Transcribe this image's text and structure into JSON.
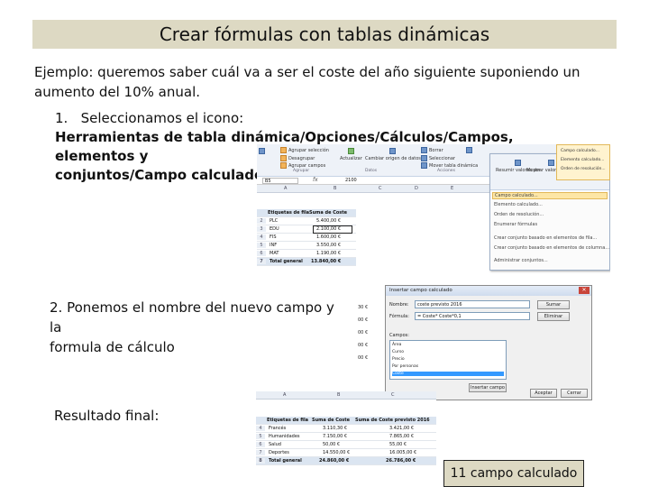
{
  "title": "Crear fórmulas con tablas dinámicas",
  "intro": "Ejemplo: queremos saber cuál va a ser el coste del año siguiente suponiendo un aumento del 10% anual.",
  "step1": {
    "number": "1.",
    "text": "Seleccionamos el icono:",
    "path_line1": "Herramientas de tabla dinámica/Opciones/Cálculos/Campos, elementos y",
    "path_line2": "conjuntos/Campo calculado"
  },
  "step2": {
    "line1": "2. Ponemos el nombre del nuevo campo y la",
    "line2": "formula de cálculo"
  },
  "step3": "Resultado final:",
  "caption": "11 campo calculado",
  "screenshot1": {
    "cell_ref": "B5",
    "fx": "fx",
    "formula_value": "2100",
    "columns": [
      "A",
      "B",
      "C",
      "D",
      "E"
    ],
    "ribbon_buttons": [
      "Agrupar selección",
      "Desagrupar",
      "Agrupar campos",
      "Actualizar",
      "Cambiar origen de datos",
      "Borrar",
      "Seleccionar",
      "Mover tabla dinámica",
      "Resumir valores por",
      "Mostrar valores como",
      "Campos, elementos y conjuntos",
      "Gráfico dinámico",
      "Herramientas OLAP"
    ],
    "ribbon_groups": [
      "Agrupar",
      "Datos",
      "Acciones",
      "Cálculos"
    ],
    "table_header": [
      "Etiquetas de fila",
      "Suma de Coste"
    ],
    "rows": [
      {
        "n": "2",
        "label": "PLC",
        "value": "5.400,00 €"
      },
      {
        "n": "3",
        "label": "EDU",
        "value": "2.100,00 €"
      },
      {
        "n": "4",
        "label": "FIS",
        "value": "1.600,00 €"
      },
      {
        "n": "5",
        "label": "INF",
        "value": "3.550,00 €"
      },
      {
        "n": "6",
        "label": "MAT",
        "value": "1.190,00 €"
      }
    ],
    "total": {
      "n": "7",
      "label": "Total general",
      "value": "13.840,00 €"
    },
    "menu_items": [
      "Campo calculado...",
      "Elemento calculado...",
      "Orden de resolución...",
      "Enumerar fórmulas",
      "Crear conjunto basado en elementos de fila...",
      "Crear conjunto basado en elementos de columna...",
      "Administrar conjuntos..."
    ],
    "submenu_items": [
      "Campo calculado...",
      "Elemento calculado...",
      "Orden de resolución..."
    ]
  },
  "screenshot2": {
    "dialog_title": "Insertar campo calculado",
    "name_label": "Nombre:",
    "name_value": "coste previsto 2016",
    "formula_label": "Fórmula:",
    "formula_value": "= Coste* Coste*0,1",
    "fields_label": "Campos:",
    "fields": [
      "Área",
      "Curso",
      "Precio",
      "Por personas",
      "Coste"
    ],
    "selected_field": "Coste",
    "btn_add": "Sumar",
    "btn_delete": "Eliminar",
    "btn_insert": "Insertar campo",
    "btn_ok": "Aceptar",
    "btn_close": "Cerrar",
    "left_values": [
      "30 €",
      "00 €",
      "00 €",
      "00 €",
      "00 €"
    ]
  },
  "screenshot3": {
    "columns": [
      "A",
      "B",
      "C"
    ],
    "header": [
      "Etiquetas de fila",
      "Suma de Coste",
      "Suma de Coste previsto 2016"
    ],
    "rows": [
      {
        "n": "4",
        "label": "Francés",
        "v1": "3.110,30 €",
        "v2": "3.421,00 €"
      },
      {
        "n": "5",
        "label": "Humanidades",
        "v1": "7.150,00 €",
        "v2": "7.865,00 €"
      },
      {
        "n": "6",
        "label": "Salud",
        "v1": "50,00 €",
        "v2": "55,00 €"
      },
      {
        "n": "7",
        "label": "Deportes",
        "v1": "14.550,00 €",
        "v2": "16.005,00 €"
      }
    ],
    "total": {
      "n": "8",
      "label": "Total general",
      "v1": "24.860,00 €",
      "v2": "26.786,00 €"
    }
  }
}
